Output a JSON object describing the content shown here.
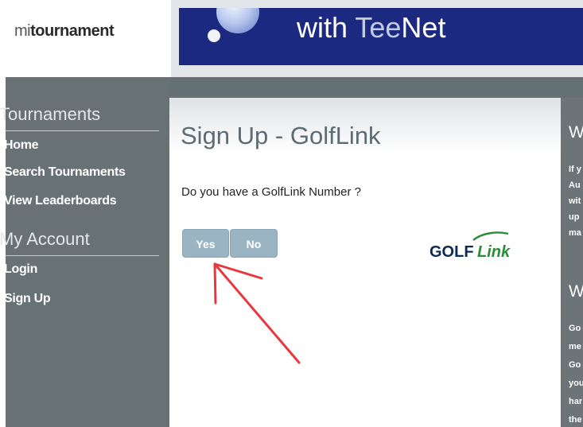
{
  "logo": {
    "prefix": "mi",
    "rest": "tournament"
  },
  "banner": {
    "text_prefix": "with ",
    "text_tee": "Tee",
    "text_suffix": "Net"
  },
  "sidebar": {
    "sections": [
      {
        "heading": "Tournaments",
        "links": [
          "Home",
          "Search Tournaments",
          "View Leaderboards"
        ]
      },
      {
        "heading": "My Account",
        "links": [
          "Login",
          "Sign Up"
        ]
      }
    ]
  },
  "main": {
    "title": "Sign Up - GolfLink",
    "question": "Do you have a GolfLink Number ?",
    "yes_label": "Yes",
    "no_label": "No",
    "golflink_logo": {
      "golf": "GOLF",
      "link": "Link"
    }
  },
  "right_panel": {
    "heading1": "W",
    "lines1": [
      "If y",
      "Au",
      "wit",
      "up",
      "ma"
    ],
    "heading2": "W",
    "lines2": [
      "Go",
      "me",
      "Go",
      "you",
      "har",
      "the"
    ]
  },
  "colors": {
    "sidebar": "#687275",
    "banner": "#1b2a80",
    "button": "#9bb4c3",
    "annotation_arrow": "#e8383d",
    "golflink_green": "#2e8b3a",
    "golflink_dark": "#0a2c55"
  }
}
